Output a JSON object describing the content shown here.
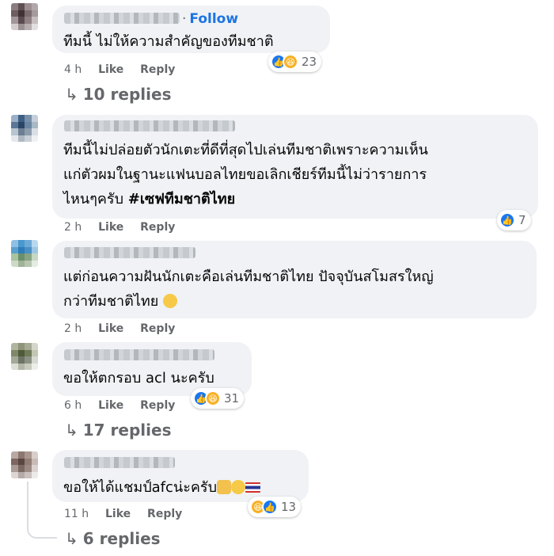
{
  "comments": [
    {
      "follow": "Follow",
      "text": [
        "ทีมนี้ ไม่ให้ความสำคัญของทีมชาติ"
      ],
      "time": "4 h",
      "like": "Like",
      "reply": "Reply",
      "reaction_count": "23",
      "reaction_icons": [
        "like-icon",
        "haha-icon"
      ],
      "replies": "10 replies"
    },
    {
      "text": [
        "ทีมนี้ไม่ปล่อยตัวนักเตะที่ดีที่สุดไปเล่นทีมชาติเพราะความเห็น",
        "แก่ตัวผมในฐานะแฟนบอลไทยขอเลิกเชียร์ทีมนี้ไม่ว่ารายการ",
        "ไหนๆครับ"
      ],
      "hashtag": "#เซฟทีมชาติไทย",
      "time": "2 h",
      "like": "Like",
      "reply": "Reply",
      "reaction_count": "7",
      "reaction_icons": [
        "like-icon"
      ]
    },
    {
      "text": [
        "แต่ก่อนความฝันนักเตะคือเล่นทีมชาติไทย ปัจจุบันสโมสรใหญ่",
        "กว่าทีมชาติไทย"
      ],
      "emoji": "rolling-eyes-emoji",
      "time": "2 h",
      "like": "Like",
      "reply": "Reply"
    },
    {
      "text": [
        "ขอให้ตกรอบ acl นะครับ"
      ],
      "time": "6 h",
      "like": "Like",
      "reply": "Reply",
      "reaction_count": "31",
      "reaction_icons": [
        "like-icon",
        "haha-icon"
      ],
      "replies": "17 replies"
    },
    {
      "text": [
        "ขอให้ได้แชมป์afcน่ะครับ"
      ],
      "emojis": [
        "pray-emoji",
        "relieved-emoji",
        "thai-flag-emoji"
      ],
      "time": "11 h",
      "like": "Like",
      "reply": "Reply",
      "reaction_count": "13",
      "reaction_icons": [
        "haha-icon",
        "like-icon"
      ],
      "replies": "6 replies"
    }
  ],
  "colors": {
    "bubble": "#f0f2f5",
    "link": "#1b74e4",
    "muted": "#65676b",
    "like": "#1877f2",
    "haha": "#f7b125"
  }
}
